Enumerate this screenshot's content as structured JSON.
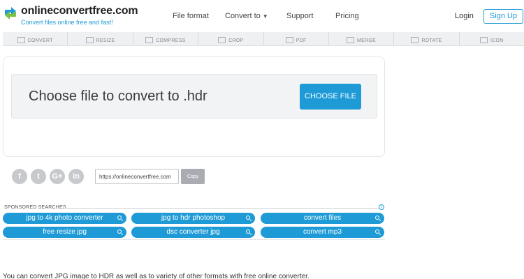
{
  "brand": {
    "name": "onlineconvertfree.com",
    "tagline": "Convert files online free and fast!",
    "accent": "#1e9bd7"
  },
  "nav": {
    "items": [
      "File format",
      "Convert to",
      "Support",
      "Pricing"
    ],
    "login": "Login",
    "signup": "Sign Up"
  },
  "tools": [
    "CONVERT",
    "RESIZE",
    "COMPRESS",
    "CROP",
    "PDF",
    "MERGE",
    "ROTATE",
    "ICON"
  ],
  "upload": {
    "prompt": "Choose file to convert to .hdr",
    "button": "CHOOSE FILE"
  },
  "share": {
    "icons": [
      "facebook-icon",
      "twitter-icon",
      "google-plus-icon",
      "linkedin-icon"
    ],
    "glyphs": [
      "f",
      "t",
      "G+",
      "in"
    ],
    "url": "https://onlineconvertfree.com",
    "copy": "Copy"
  },
  "sponsored": {
    "label": "SPONSORED SEARCHES",
    "searches": [
      "jpg to 4k photo converter",
      "jpg to hdr photoshop",
      "convert files",
      "free resize jpg",
      "dsc converter jpg",
      "convert mp3"
    ]
  },
  "content": {
    "intro": "You can convert JPG image to HDR as well as to variety of other formats with free online converter."
  }
}
